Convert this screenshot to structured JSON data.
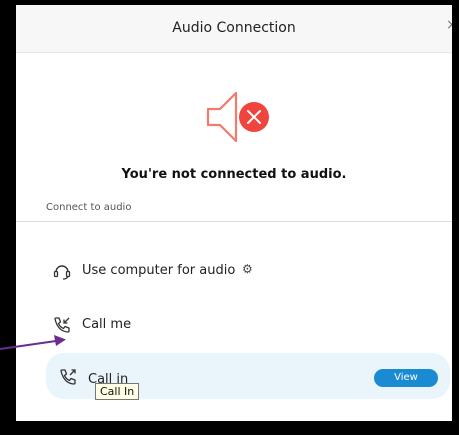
{
  "dialog": {
    "title": "Audio Connection",
    "close_glyph": "×",
    "status_text": "You're not connected to audio.",
    "section_label": "Connect to audio"
  },
  "options": [
    {
      "label": "Use computer for audio",
      "icon": "headset-icon",
      "extra_icon": "gear-icon"
    },
    {
      "label": "Call me",
      "icon": "phone-incoming-icon"
    },
    {
      "label": "Call in",
      "icon": "phone-outgoing-icon",
      "button_label": "View",
      "highlighted": true
    }
  ],
  "tooltip": "Call In",
  "colors": {
    "speaker_outline": "#f47a6e",
    "speaker_badge": "#f0453e",
    "view_button": "#1a8ad2",
    "highlight_row": "#eaf4fb",
    "annotation_arrow": "#6a2c91"
  }
}
